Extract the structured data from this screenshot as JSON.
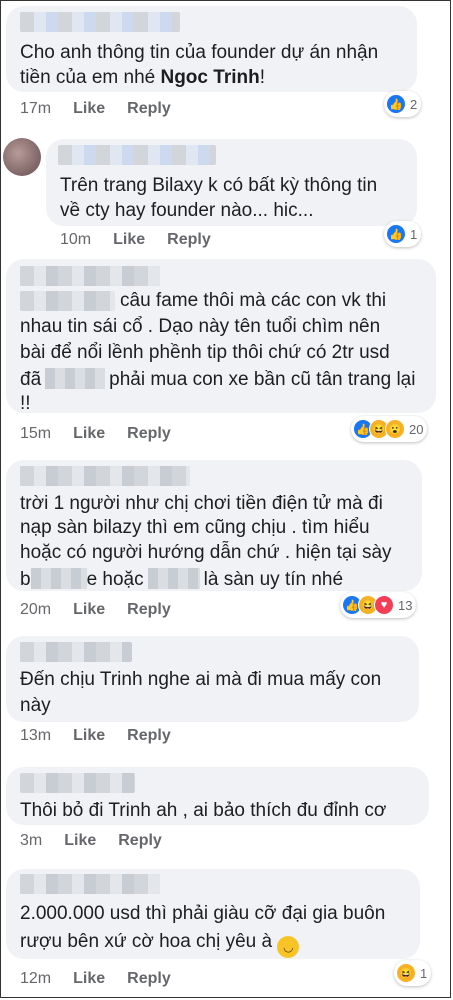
{
  "comments": [
    {
      "lines": [
        "Cho anh thông tin của founder dự án nhận",
        "tiền của em nhé "
      ],
      "bold": "Ngoc Trinh",
      "bold_suffix": "!",
      "time": "17m",
      "like": "Like",
      "reply": "Reply",
      "reaction_count": "2",
      "reactions": [
        "like"
      ]
    },
    {
      "lines": [
        "Trên trang Bilaxy k có bất kỳ thông tin",
        "về cty hay founder nào... hic..."
      ],
      "time": "10m",
      "like": "Like",
      "reply": "Reply",
      "reaction_count": "1",
      "reactions": [
        "like"
      ]
    },
    {
      "lines": [
        "câu fame thôi mà các con vk thi",
        "nhau tin sái cổ . Dạo này tên tuổi chìm nên",
        "bài để nổi lềnh phềnh tip thôi chứ có 2tr usd",
        "đã",
        "phải mua con xe bần cũ tân trang lại",
        "!!"
      ],
      "time": "15m",
      "like": "Like",
      "reply": "Reply",
      "reaction_count": "20",
      "reactions": [
        "like",
        "haha",
        "wow"
      ]
    },
    {
      "lines": [
        "trời 1 người như chị chơi tiền điện tử mà đi",
        "nạp sàn bilazy thì em cũng chịu . tìm hiểu",
        "hoặc có người hướng dẫn chứ . hiện tại sày",
        "b",
        "e hoặc",
        "là sàn uy tín nhé"
      ],
      "time": "20m",
      "like": "Like",
      "reply": "Reply",
      "reaction_count": "13",
      "reactions": [
        "like",
        "haha",
        "love"
      ]
    },
    {
      "lines": [
        "Đến chịu Trinh nghe ai mà đi mua mấy con",
        "này"
      ],
      "time": "13m",
      "like": "Like",
      "reply": "Reply"
    },
    {
      "lines": [
        "Thôi bỏ đi Trinh ah , ai bảo thích đu đỉnh cơ"
      ],
      "time": "3m",
      "like": "Like",
      "reply": "Reply"
    },
    {
      "lines": [
        "2.000.000 usd thì phải giàu cỡ đại gia buôn",
        "rượu bên xứ cờ hoa chị yêu à"
      ],
      "time": "12m",
      "like": "Like",
      "reply": "Reply",
      "reaction_count": "1",
      "reactions": [
        "haha"
      ]
    }
  ],
  "icons": {
    "like": "like-icon",
    "haha": "haha-icon",
    "wow": "wow-icon",
    "love": "love-icon",
    "smile": "smile-emoji"
  }
}
